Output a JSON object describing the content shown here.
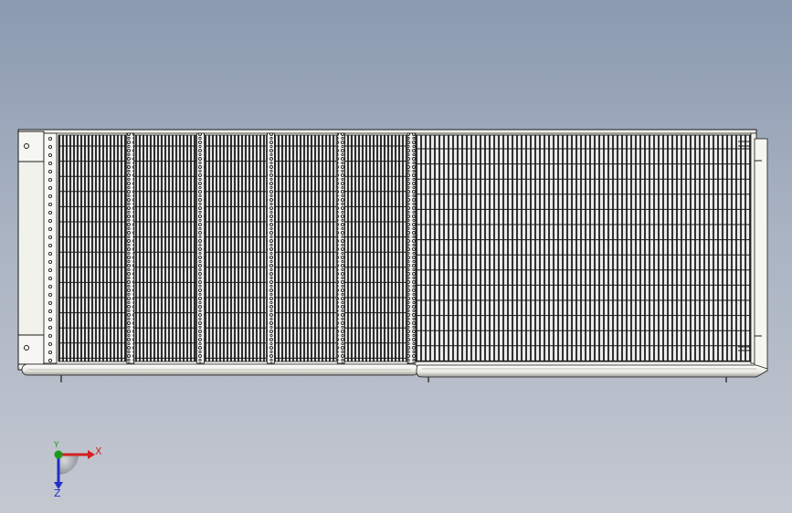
{
  "viewport": {
    "background_top": "#8b9ab0",
    "background_bottom": "#c4c8d1"
  },
  "model": {
    "name": "condenser-coil-assembly",
    "left_coil_module_count": 5,
    "frame_color": "#f2f2ec",
    "fin_color": "#3a3a3a"
  },
  "triad": {
    "x_label": "X",
    "y_label": "Y",
    "z_label": "Z",
    "x_color": "#d42020",
    "y_color": "#1a9a1a",
    "z_color": "#2030c8"
  }
}
